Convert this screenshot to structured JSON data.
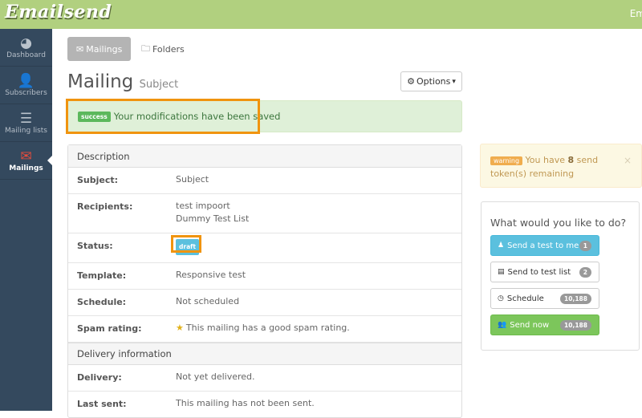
{
  "header": {
    "logo": "Emailsend",
    "user_partial": "Em"
  },
  "sidebar": {
    "items": [
      {
        "label": "Dashboard",
        "icon": "dashboard-icon",
        "glyph": "◕",
        "active": false
      },
      {
        "label": "Subscribers",
        "icon": "user-icon",
        "glyph": "👤",
        "active": false
      },
      {
        "label": "Mailing lists",
        "icon": "list-icon",
        "glyph": "☰",
        "active": false
      },
      {
        "label": "Mailings",
        "icon": "envelope-icon",
        "glyph": "✉",
        "active": true
      }
    ]
  },
  "tabs": [
    {
      "label": "Mailings",
      "glyph": "✉",
      "active": true
    },
    {
      "label": "Folders",
      "glyph": "🗀",
      "active": false
    }
  ],
  "page": {
    "title": "Mailing",
    "subtitle": "Subject",
    "options_label": "Options",
    "options_glyph": "⚙",
    "caret": "▾"
  },
  "success_alert": {
    "badge": "success",
    "message": "Your modifications have been saved"
  },
  "description": {
    "heading": "Description",
    "rows": [
      {
        "label": "Subject:",
        "value": "Subject"
      },
      {
        "label": "Recipients:",
        "value": "test impoort",
        "value2": "Dummy Test List"
      },
      {
        "label": "Status:",
        "badge": "draft"
      },
      {
        "label": "Template:",
        "value": "Responsive test"
      },
      {
        "label": "Schedule:",
        "value": "Not scheduled"
      },
      {
        "label": "Spam rating:",
        "value": "This mailing has a good spam rating.",
        "icon": "award-icon"
      }
    ]
  },
  "delivery": {
    "heading": "Delivery information",
    "rows": [
      {
        "label": "Delivery:",
        "value": "Not yet delivered."
      },
      {
        "label": "Last sent:",
        "value": "This mailing has not been sent."
      }
    ]
  },
  "warning_alert": {
    "badge": "warning",
    "pre": "You have",
    "count": "8",
    "post": "send token(s) remaining",
    "close": "×"
  },
  "actions": {
    "heading": "What would you like to do?",
    "buttons": [
      {
        "label": "Send a test to me",
        "count": "1",
        "glyph": "♟"
      },
      {
        "label": "Send to test list",
        "count": "2",
        "glyph": "▤"
      },
      {
        "label": "Schedule",
        "count": "10,188",
        "glyph": "◷"
      },
      {
        "label": "Send now",
        "count": "10,188",
        "glyph": "👥"
      }
    ]
  },
  "colors": {
    "topbar": "#b1d07f",
    "sidebar": "#34495e",
    "active_nav": "#e74c3c",
    "highlight": "#f0940f"
  }
}
